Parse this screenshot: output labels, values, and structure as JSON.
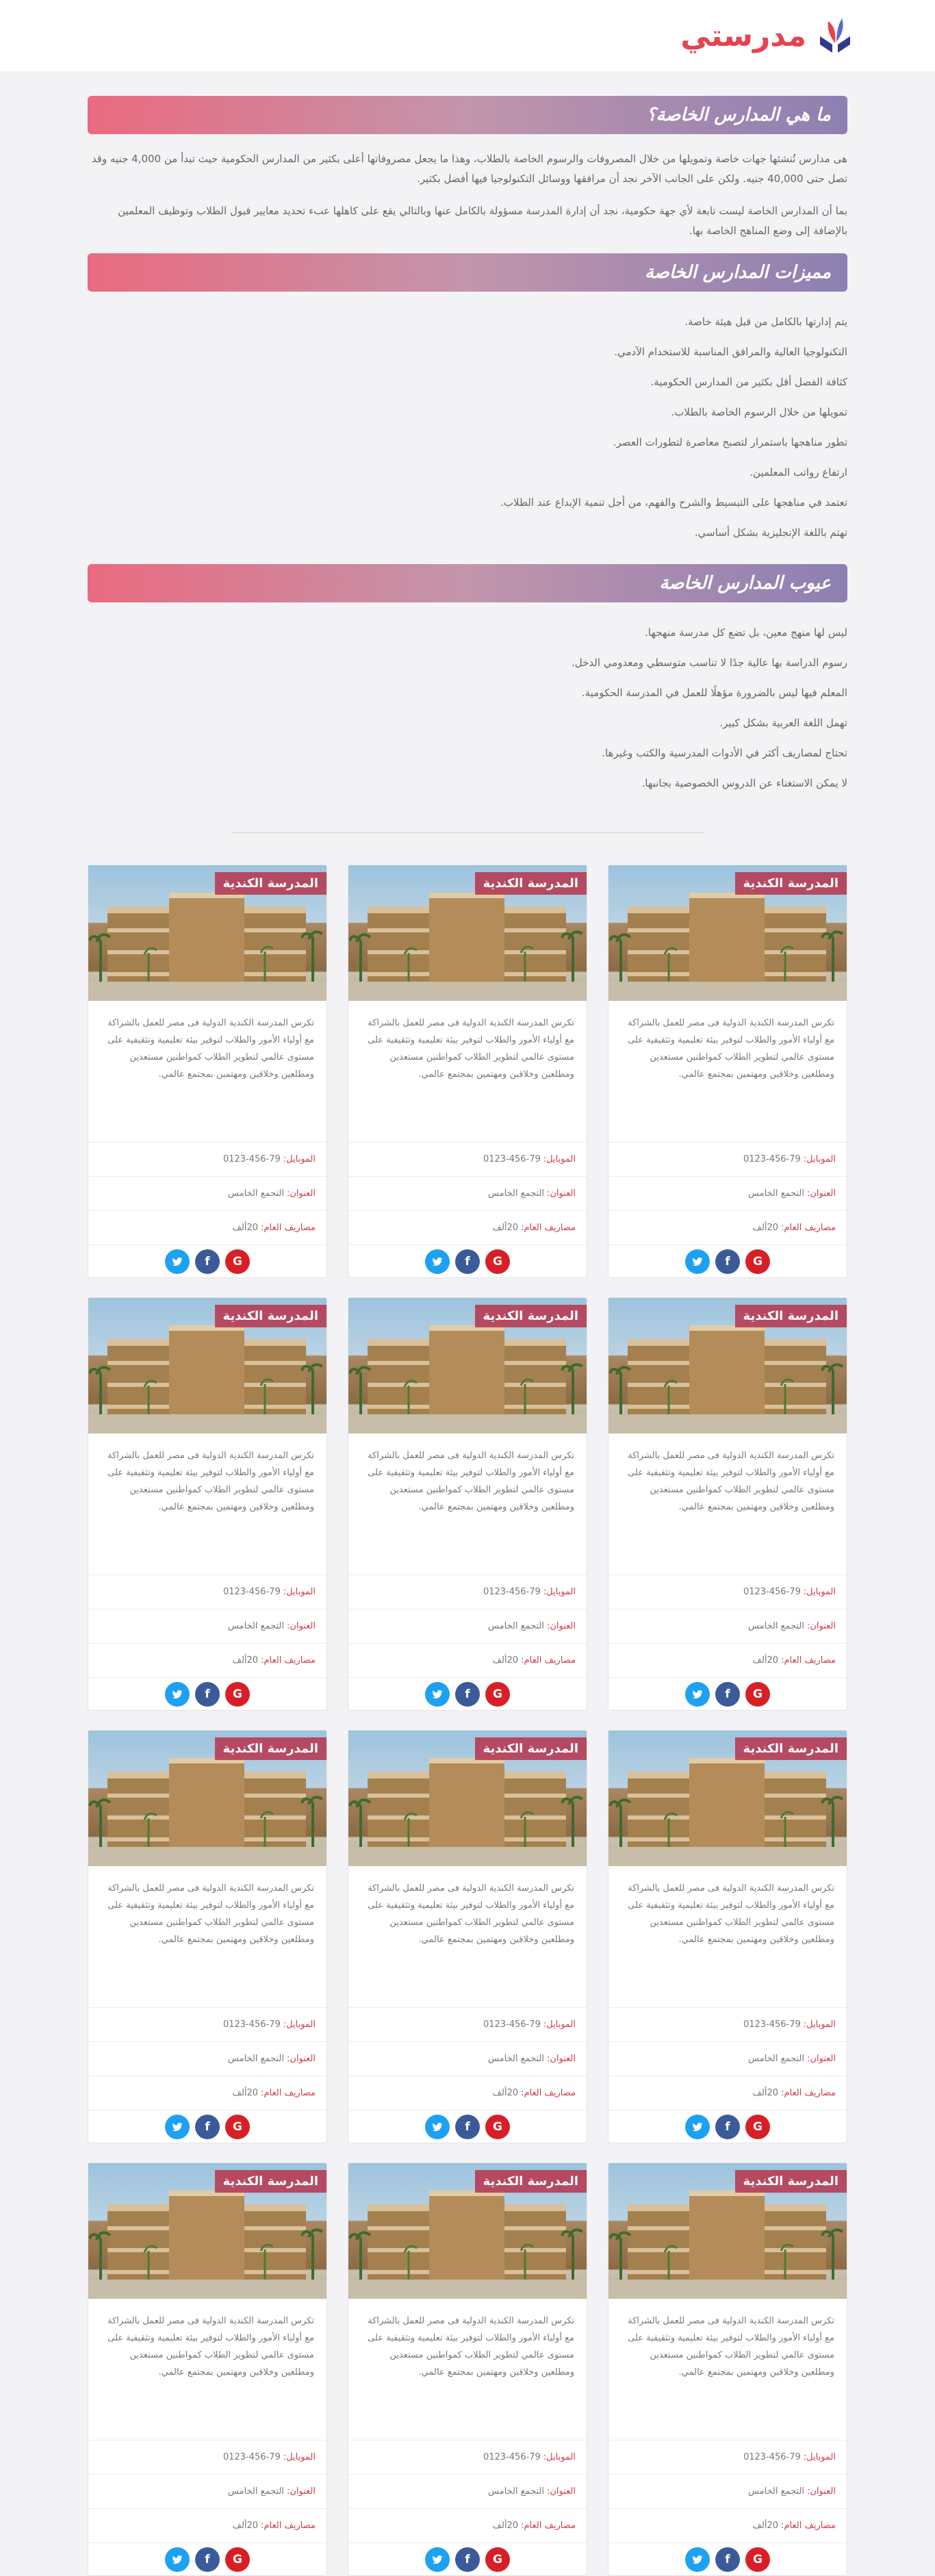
{
  "header": {
    "logo_text": "مدرستي",
    "logo_icon": "book-icon"
  },
  "sections": {
    "what": {
      "title": "ما هي المدارس الخاصة؟",
      "p1": "هى مدارس تُنشئها جهات خاصة وتمويلها من خلال المصروفات والرسوم الخاصة بالطلاب، وهذا ما يجعل مصروفاتها أعلى بكثير من المدارس الحكومية حيث تبدأ من 4,000 جنيه وقد تصل حتى 40,000 جنيه. ولكن على الجانب الآخر نجد أن مرافقها ووسائل التكنولوجيا فيها أفضل بكثير.",
      "p2": "بما أن المدارس الخاصة ليست تابعة لأي جهة حكومية، نجد أن إدارة المدرسة مسؤولة بالكامل عنها وبالتالي يقع على كاهلها عبء تحديد معايير قبول الطلاب وتوظيف المعلمين بالإضافة إلى وضع المناهج الخاصة بها."
    },
    "features": {
      "title": "مميزات المدارس الخاصة",
      "items": [
        "يتم إدارتها بالكامل من قبل هيئة خاصة.",
        "التكنولوجيا العالية والمرافق المناسبة للاستخدام الآدمي.",
        "كثافة الفصل أقل بكثير من المدارس الحكومية.",
        "تمويلها من خلال الرسوم الخاصة بالطلاب.",
        "تطور مناهجها باستمرار لتصبح معاصرة لتطورات العصر.",
        "ارتفاع رواتب المعلمين.",
        "تعتمد في مناهجها على التبسيط والشرح والفهم، من أجل تنمية الإبداع عند الطلاب.",
        "تهتم باللغة الإنجليزية بشكل أساسي."
      ]
    },
    "drawbacks": {
      "title": "عيوب المدارس الخاصة",
      "items": [
        "ليس لها منهج معين، بل تضع كل مدرسة منهجها.",
        "رسوم الدراسة بها عالية جدًا لا تناسب متوسطي ومعدومي الدخل.",
        "المعلم فيها ليس بالضرورة مؤهلًا للعمل في المدرسة الحكومية.",
        "تهمل اللغة العربية بشكل كبير.",
        "تحتاج لمصاريف أكثر في الأدوات المدرسية والكتب وغيرها.",
        "لا يمكن الاستغناء عن الدروس الخصوصية بجانبها."
      ]
    }
  },
  "cards": [
    {
      "name": "المدرسة الكندية",
      "desc": "تكرس المدرسة الكندية الدولية فى مصر للعمل بالشراكة مع أولياء الأمور والطلاب لتوفير بيئة تعليمية وتثقيفية على مستوى عالمي لتطوير الطلاب كمواطنين مستعدين ومطلعين وخلاقين ومهتمين بمجتمع عالمي.",
      "phone_label": "الموبايل:",
      "phone": "0123-456-79",
      "address_label": "العنوان:",
      "address": "التجمع الخامس",
      "fees_label": "مصاريف العام:",
      "fees": "20ألف"
    },
    {
      "name": "المدرسة الكندية",
      "desc": "تكرس المدرسة الكندية الدولية فى مصر للعمل بالشراكة مع أولياء الأمور والطلاب لتوفير بيئة تعليمية وتثقيفية على مستوى عالمي لتطوير الطلاب كمواطنين مستعدين ومطلعين وخلاقين ومهتمين بمجتمع عالمي.",
      "phone_label": "الموبايل:",
      "phone": "0123-456-79",
      "address_label": "العنوان:",
      "address": "التجمع الخامس",
      "fees_label": "مصاريف العام:",
      "fees": "20ألف"
    },
    {
      "name": "المدرسة الكندية",
      "desc": "تكرس المدرسة الكندية الدولية فى مصر للعمل بالشراكة مع أولياء الأمور والطلاب لتوفير بيئة تعليمية وتثقيفية على مستوى عالمي لتطوير الطلاب كمواطنين مستعدين ومطلعين وخلاقين ومهتمين بمجتمع عالمي.",
      "phone_label": "الموبايل:",
      "phone": "0123-456-79",
      "address_label": "العنوان:",
      "address": "التجمع الخامس",
      "fees_label": "مصاريف العام:",
      "fees": "20ألف"
    },
    {
      "name": "المدرسة الكندية",
      "desc": "تكرس المدرسة الكندية الدولية فى مصر للعمل بالشراكة مع أولياء الأمور والطلاب لتوفير بيئة تعليمية وتثقيفية على مستوى عالمي لتطوير الطلاب كمواطنين مستعدين ومطلعين وخلاقين ومهتمين بمجتمع عالمي.",
      "phone_label": "الموبايل:",
      "phone": "0123-456-79",
      "address_label": "العنوان:",
      "address": "التجمع الخامس",
      "fees_label": "مصاريف العام:",
      "fees": "20ألف"
    },
    {
      "name": "المدرسة الكندية",
      "desc": "تكرس المدرسة الكندية الدولية فى مصر للعمل بالشراكة مع أولياء الأمور والطلاب لتوفير بيئة تعليمية وتثقيفية على مستوى عالمي لتطوير الطلاب كمواطنين مستعدين ومطلعين وخلاقين ومهتمين بمجتمع عالمي.",
      "phone_label": "الموبايل:",
      "phone": "0123-456-79",
      "address_label": "العنوان:",
      "address": "التجمع الخامس",
      "fees_label": "مصاريف العام:",
      "fees": "20ألف"
    },
    {
      "name": "المدرسة الكندية",
      "desc": "تكرس المدرسة الكندية الدولية فى مصر للعمل بالشراكة مع أولياء الأمور والطلاب لتوفير بيئة تعليمية وتثقيفية على مستوى عالمي لتطوير الطلاب كمواطنين مستعدين ومطلعين وخلاقين ومهتمين بمجتمع عالمي.",
      "phone_label": "الموبايل:",
      "phone": "0123-456-79",
      "address_label": "العنوان:",
      "address": "التجمع الخامس",
      "fees_label": "مصاريف العام:",
      "fees": "20ألف"
    },
    {
      "name": "المدرسة الكندية",
      "desc": "تكرس المدرسة الكندية الدولية فى مصر للعمل بالشراكة مع أولياء الأمور والطلاب لتوفير بيئة تعليمية وتثقيفية على مستوى عالمي لتطوير الطلاب كمواطنين مستعدين ومطلعين وخلاقين ومهتمين بمجتمع عالمي.",
      "phone_label": "الموبايل:",
      "phone": "0123-456-79",
      "address_label": "العنوان:",
      "address": "التجمع الخامس",
      "fees_label": "مصاريف العام:",
      "fees": "20ألف"
    },
    {
      "name": "المدرسة الكندية",
      "desc": "تكرس المدرسة الكندية الدولية فى مصر للعمل بالشراكة مع أولياء الأمور والطلاب لتوفير بيئة تعليمية وتثقيفية على مستوى عالمي لتطوير الطلاب كمواطنين مستعدين ومطلعين وخلاقين ومهتمين بمجتمع عالمي.",
      "phone_label": "الموبايل:",
      "phone": "0123-456-79",
      "address_label": "العنوان:",
      "address": "التجمع الخامس",
      "fees_label": "مصاريف العام:",
      "fees": "20ألف"
    },
    {
      "name": "المدرسة الكندية",
      "desc": "تكرس المدرسة الكندية الدولية فى مصر للعمل بالشراكة مع أولياء الأمور والطلاب لتوفير بيئة تعليمية وتثقيفية على مستوى عالمي لتطوير الطلاب كمواطنين مستعدين ومطلعين وخلاقين ومهتمين بمجتمع عالمي.",
      "phone_label": "الموبايل:",
      "phone": "0123-456-79",
      "address_label": "العنوان:",
      "address": "التجمع الخامس",
      "fees_label": "مصاريف العام:",
      "fees": "20ألف"
    },
    {
      "name": "المدرسة الكندية",
      "desc": "تكرس المدرسة الكندية الدولية فى مصر للعمل بالشراكة مع أولياء الأمور والطلاب لتوفير بيئة تعليمية وتثقيفية على مستوى عالمي لتطوير الطلاب كمواطنين مستعدين ومطلعين وخلاقين ومهتمين بمجتمع عالمي.",
      "phone_label": "الموبايل:",
      "phone": "0123-456-79",
      "address_label": "العنوان:",
      "address": "التجمع الخامس",
      "fees_label": "مصاريف العام:",
      "fees": "20ألف"
    },
    {
      "name": "المدرسة الكندية",
      "desc": "تكرس المدرسة الكندية الدولية فى مصر للعمل بالشراكة مع أولياء الأمور والطلاب لتوفير بيئة تعليمية وتثقيفية على مستوى عالمي لتطوير الطلاب كمواطنين مستعدين ومطلعين وخلاقين ومهتمين بمجتمع عالمي.",
      "phone_label": "الموبايل:",
      "phone": "0123-456-79",
      "address_label": "العنوان:",
      "address": "التجمع الخامس",
      "fees_label": "مصاريف العام:",
      "fees": "20ألف"
    },
    {
      "name": "المدرسة الكندية",
      "desc": "تكرس المدرسة الكندية الدولية فى مصر للعمل بالشراكة مع أولياء الأمور والطلاب لتوفير بيئة تعليمية وتثقيفية على مستوى عالمي لتطوير الطلاب كمواطنين مستعدين ومطلعين وخلاقين ومهتمين بمجتمع عالمي.",
      "phone_label": "الموبايل:",
      "phone": "0123-456-79",
      "address_label": "العنوان:",
      "address": "التجمع الخامس",
      "fees_label": "مصاريف العام:",
      "fees": "20ألف"
    }
  ],
  "social_icons": [
    "google-plus-icon",
    "facebook-icon",
    "twitter-icon"
  ],
  "colors": {
    "accent": "#e5444f",
    "banner_left": "#ea6a80",
    "banner_right": "#8d80b3",
    "label": "#d33b4a",
    "google": "#d91f26",
    "facebook": "#3b5a9a",
    "twitter": "#1da1f2"
  }
}
